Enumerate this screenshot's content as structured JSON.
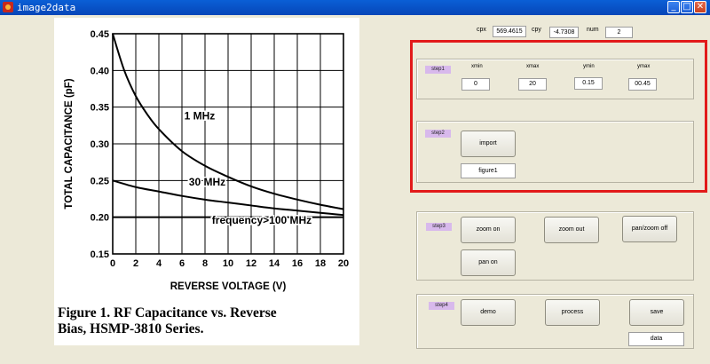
{
  "window": {
    "title": "image2data",
    "buttons": {
      "minimize": "_",
      "maximize": "□",
      "close": "✕"
    },
    "icon": "matlab-icon"
  },
  "readouts": {
    "cpx_label": "cpx",
    "cpx_value": "569.4615",
    "cpy_label": "cpy",
    "cpy_value": "-4.7308",
    "num_label": "num",
    "num_value": "2"
  },
  "step1": {
    "tag": "step1",
    "xmin_label": "xmin",
    "xmin_value": "0",
    "xmax_label": "xmax",
    "xmax_value": "20",
    "ymin_label": "ymin",
    "ymin_value": "0.15",
    "ymax_label": "ymax",
    "ymax_value": "00.45"
  },
  "step2": {
    "tag": "step2",
    "import_label": "import",
    "figure_value": "figure1"
  },
  "step3": {
    "tag": "step3",
    "zoom_on": "zoom on",
    "zoom_out": "zoom out",
    "pan_zoom_off": "pan/zoom off",
    "pan_on": "pan on"
  },
  "step4": {
    "tag": "step4",
    "demo": "demo",
    "process": "process",
    "save": "save",
    "data_value": "data"
  },
  "colors": {
    "highlight": "#e21a1a",
    "step_tag": "#d8b9ec",
    "titlebar": "#0a5fd6"
  },
  "figure": {
    "caption_line1": "Figure 1.  RF Capacitance vs. Reverse",
    "caption_line2": "Bias, HSMP-3810 Series.",
    "chart_data": {
      "type": "line",
      "xlabel": "REVERSE VOLTAGE (V)",
      "ylabel": "TOTAL CAPACITANCE (pF)",
      "xlim": [
        0,
        20
      ],
      "ylim": [
        0.15,
        0.45
      ],
      "x_ticks": [
        0,
        2,
        4,
        6,
        8,
        10,
        12,
        14,
        16,
        18,
        20
      ],
      "y_ticks": [
        0.15,
        0.2,
        0.25,
        0.3,
        0.35,
        0.4,
        0.45
      ],
      "y_tick_labels": [
        "0.15",
        "0.20",
        "0.25",
        "0.30",
        "0.35",
        "0.40",
        "0.45"
      ],
      "grid": true,
      "series": [
        {
          "name": "1 MHz",
          "x": [
            0,
            1,
            2,
            3,
            4,
            6,
            8,
            10,
            12,
            14,
            16,
            18,
            20
          ],
          "values": [
            0.45,
            0.4,
            0.365,
            0.34,
            0.32,
            0.29,
            0.27,
            0.255,
            0.242,
            0.232,
            0.224,
            0.217,
            0.211
          ]
        },
        {
          "name": "30 MHz",
          "x": [
            0,
            2,
            4,
            6,
            8,
            10,
            12,
            14,
            16,
            18,
            20
          ],
          "values": [
            0.25,
            0.241,
            0.235,
            0.229,
            0.224,
            0.22,
            0.216,
            0.212,
            0.209,
            0.206,
            0.203
          ]
        },
        {
          "name": "frequency>100 MHz",
          "x": [
            0,
            20
          ],
          "values": [
            0.2,
            0.2
          ]
        }
      ]
    }
  }
}
